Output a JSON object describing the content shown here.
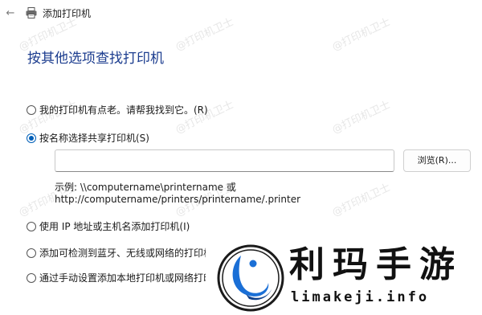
{
  "window": {
    "title": "添加打印机"
  },
  "heading": "按其他选项查找打印机",
  "options": [
    {
      "label": "我的打印机有点老。请帮我找到它。(R)",
      "checked": false
    },
    {
      "label": "按名称选择共享打印机(S)",
      "checked": true
    },
    {
      "label": "使用 IP 地址或主机名添加打印机(I)",
      "checked": false
    },
    {
      "label": "添加可检测到蓝牙、无线或网络的打印机",
      "checked": false
    },
    {
      "label": "通过手动设置添加本地打印机或网络打印机",
      "checked": false
    }
  ],
  "shared_printer": {
    "input_value": "",
    "browse_label": "浏览(R)...",
    "example_line1": "示例: \\\\computername\\printername 或",
    "example_line2": "http://computername/printers/printername/.printer"
  },
  "watermark": "@打印机卫士",
  "overlay": {
    "brand": "利玛手游",
    "url": "limakeji.info",
    "accent_color": "#1a6fd6"
  },
  "icons": {
    "back": "arrow-left-icon",
    "printer": "printer-icon"
  }
}
